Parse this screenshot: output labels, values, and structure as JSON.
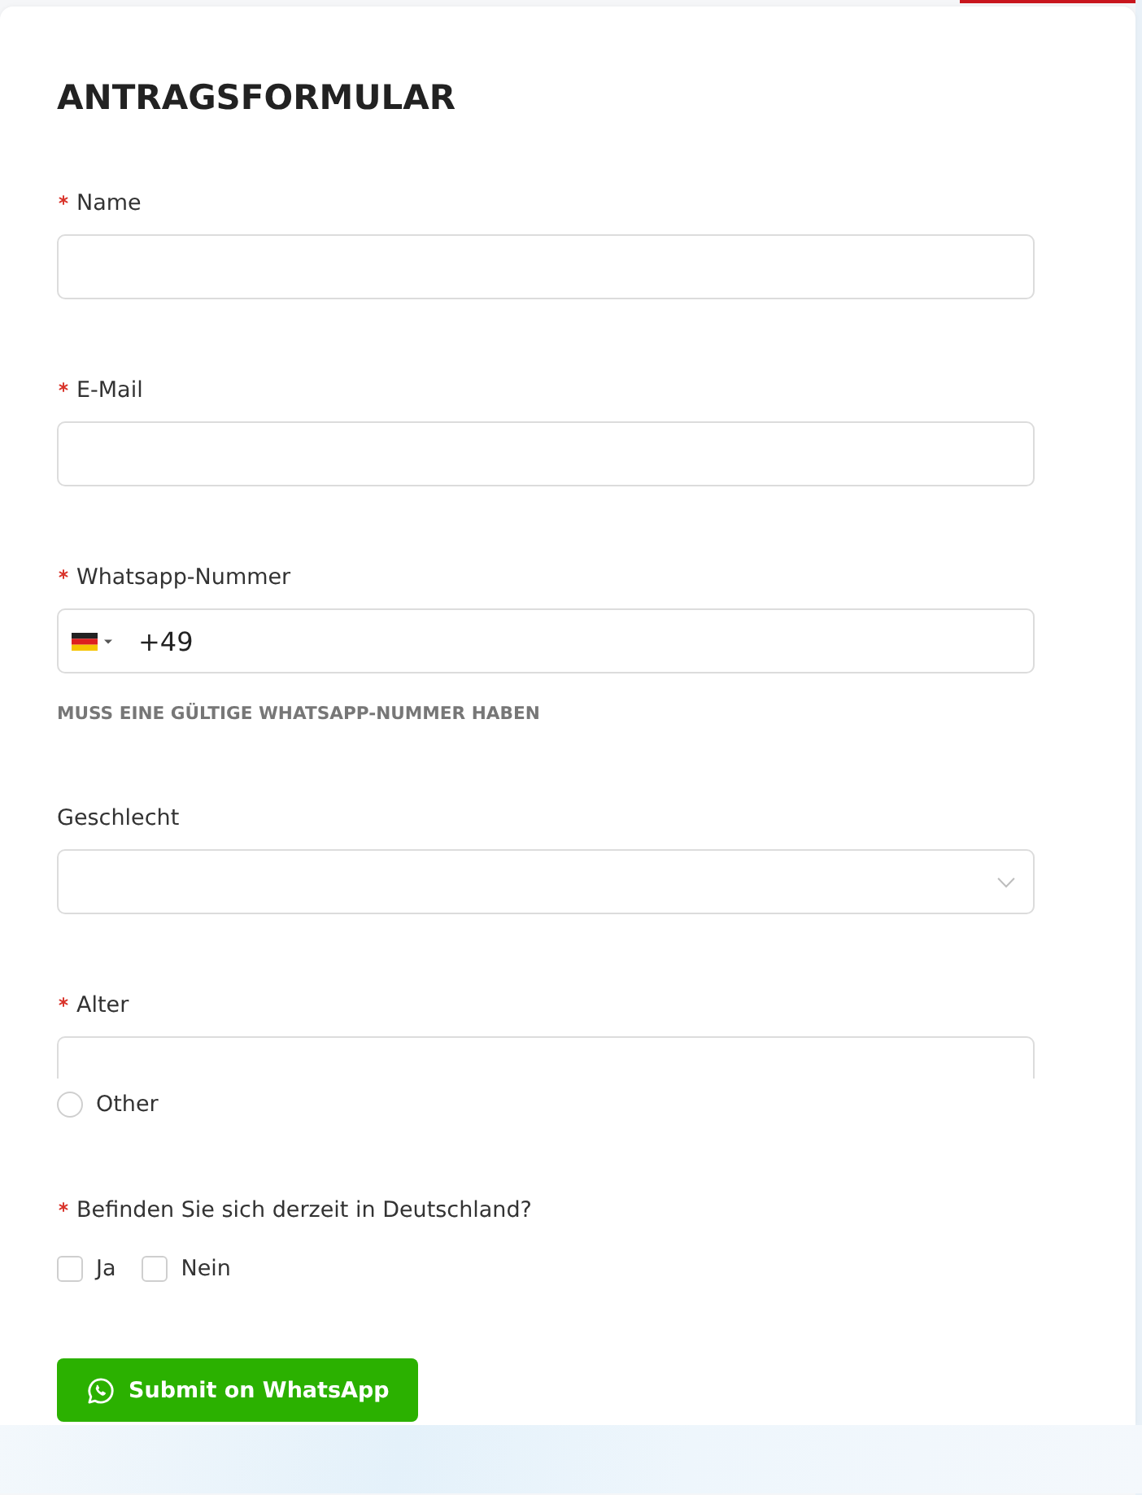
{
  "form": {
    "title": "ANTRAGSFORMULAR",
    "fields": [
      {
        "kind": "text",
        "label": "Name",
        "required": true
      },
      {
        "kind": "text",
        "label": "E-Mail",
        "required": true
      },
      {
        "kind": "phone",
        "label": "Whatsapp-Nummer",
        "required": true,
        "value": "+49",
        "hint": "MUSS EINE GÜLTIGE WHATSAPP-NUMMER HABEN"
      },
      {
        "kind": "select",
        "label": "Geschlecht",
        "required": false
      },
      {
        "kind": "clipped",
        "label": "Alter",
        "required": true,
        "options": [
          {
            "label": "Other",
            "selected": false
          }
        ]
      },
      {
        "kind": "checkbox",
        "label": "Befinden Sie sich derzeit in Deutschland?",
        "required": true,
        "options": [
          {
            "label": "Ja",
            "checked": false
          },
          {
            "label": "Nein",
            "checked": false
          }
        ]
      }
    ],
    "submit": {
      "label": "Submit on WhatsApp"
    }
  }
}
